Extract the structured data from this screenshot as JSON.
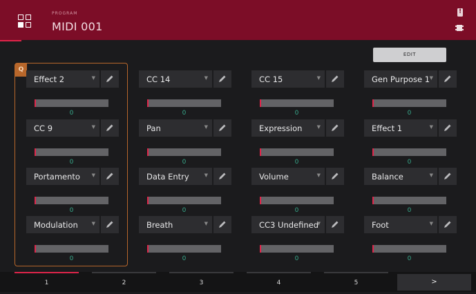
{
  "header": {
    "label": "PROGRAM",
    "title": "MIDI 001",
    "accent": "#e0254a",
    "bg": "#7c0d27"
  },
  "edit_label": "EDIT",
  "q_badge": "Q",
  "controls": [
    {
      "label": "Effect 2",
      "value": "0"
    },
    {
      "label": "CC 14",
      "value": "0"
    },
    {
      "label": "CC 15",
      "value": "0"
    },
    {
      "label": "Gen Purpose 1",
      "value": "0"
    },
    {
      "label": "CC 9",
      "value": "0"
    },
    {
      "label": "Pan",
      "value": "0"
    },
    {
      "label": "Expression",
      "value": "0"
    },
    {
      "label": "Effect 1",
      "value": "0"
    },
    {
      "label": "Portamento",
      "value": "0"
    },
    {
      "label": "Data Entry",
      "value": "0"
    },
    {
      "label": "Volume",
      "value": "0"
    },
    {
      "label": "Balance",
      "value": "0"
    },
    {
      "label": "Modulation",
      "value": "0"
    },
    {
      "label": "Breath",
      "value": "0"
    },
    {
      "label": "CC3 Undefined",
      "value": "0"
    },
    {
      "label": "Foot",
      "value": "0"
    }
  ],
  "pages": [
    "1",
    "2",
    "3",
    "4",
    "5"
  ],
  "active_page": "1",
  "next_label": ">",
  "icons": [
    "grid-icon",
    "alert-icon",
    "chip-icon",
    "pencil-icon",
    "caret-down-icon"
  ]
}
